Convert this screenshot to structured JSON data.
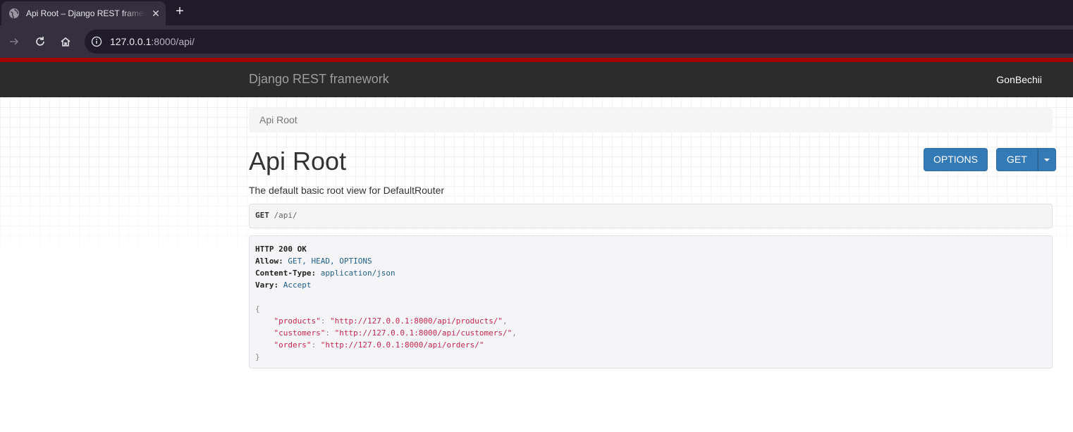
{
  "browser": {
    "tab_title": "Api Root – Django REST framework",
    "url_host": "127.0.0.1",
    "url_rest": ":8000/api/"
  },
  "navbar": {
    "brand": "Django REST framework",
    "username": "GonBechii"
  },
  "breadcrumb": "Api Root",
  "page": {
    "title": "Api Root",
    "description": "The default basic root view for DefaultRouter",
    "options_label": "OPTIONS",
    "get_label": "GET"
  },
  "request": {
    "method": "GET",
    "path": "/api/"
  },
  "response": {
    "status": "HTTP 200 OK",
    "headers": [
      {
        "key": "Allow:",
        "value": "GET, HEAD, OPTIONS"
      },
      {
        "key": "Content-Type:",
        "value": "application/json"
      },
      {
        "key": "Vary:",
        "value": "Accept"
      }
    ],
    "open_brace": "{",
    "close_brace": "}",
    "body": [
      {
        "key": "\"products\"",
        "value": "\"http://127.0.0.1:8000/api/products/\"",
        "sep": ","
      },
      {
        "key": "\"customers\"",
        "value": "\"http://127.0.0.1:8000/api/customers/\"",
        "sep": ","
      },
      {
        "key": "\"orders\"",
        "value": "\"http://127.0.0.1:8000/api/orders/\"",
        "sep": ""
      }
    ]
  },
  "colors": {
    "accent_red": "#a30000",
    "navbar_bg": "#2c2c2c",
    "button_blue": "#337ab7"
  },
  "icons": [
    "globe-icon",
    "close-icon",
    "plus-icon",
    "forward-icon",
    "reload-icon",
    "home-icon",
    "info-icon",
    "caret-down-icon"
  ]
}
